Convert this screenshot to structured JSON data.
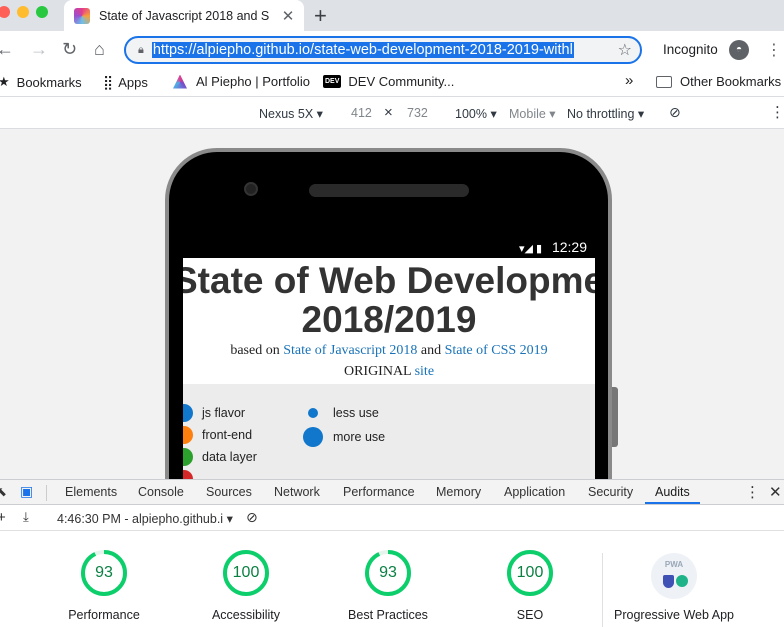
{
  "browser": {
    "tab_title": "State of Javascript 2018 and S",
    "url": "https://alpiepho.github.io/state-web-development-2018-2019-withl",
    "incognito_label": "Incognito"
  },
  "bookmarks": {
    "items": [
      "Bookmarks",
      "Apps",
      "Al Piepho | Portfolio",
      "DEV Community..."
    ],
    "overflow": "»",
    "other": "Other Bookmarks"
  },
  "device_toolbar": {
    "device": "Nexus 5X",
    "width": "412",
    "times": "×",
    "height": "732",
    "zoom": "100%",
    "mode": "Mobile",
    "throttling": "No throttling"
  },
  "page": {
    "status_time": "12:29",
    "headline_1": "State of Web Developmen",
    "headline_2": "2018/2019",
    "based_on": "based on",
    "link_js": "State of Javascript 2018",
    "and": "and",
    "link_css": "State of CSS 2019",
    "original": "ORIGINAL",
    "site": "site",
    "legend": {
      "types": [
        "js flavor",
        "front-end",
        "data layer"
      ],
      "sizes": [
        "less use",
        "more use"
      ]
    }
  },
  "devtools": {
    "tabs": [
      "Elements",
      "Console",
      "Sources",
      "Network",
      "Performance",
      "Memory",
      "Application",
      "Security",
      "Audits"
    ],
    "active_tab": "Audits",
    "report": "4:46:30 PM - alpiepho.github.i",
    "scores": [
      {
        "label": "Performance",
        "value": "93",
        "fraction": 0.93
      },
      {
        "label": "Accessibility",
        "value": "100",
        "fraction": 1.0
      },
      {
        "label": "Best Practices",
        "value": "93",
        "fraction": 0.93
      },
      {
        "label": "SEO",
        "value": "100",
        "fraction": 1.0
      }
    ],
    "pwa_label": "Progressive Web App",
    "pwa_badge": "PWA"
  },
  "colors": {
    "accent": "#1a73e8",
    "pass_green": "#0cce6b",
    "js_flavor": "#1177cc",
    "front_end": "#ff7f0e",
    "data_layer": "#2ca02c",
    "extra": "#d62728"
  }
}
